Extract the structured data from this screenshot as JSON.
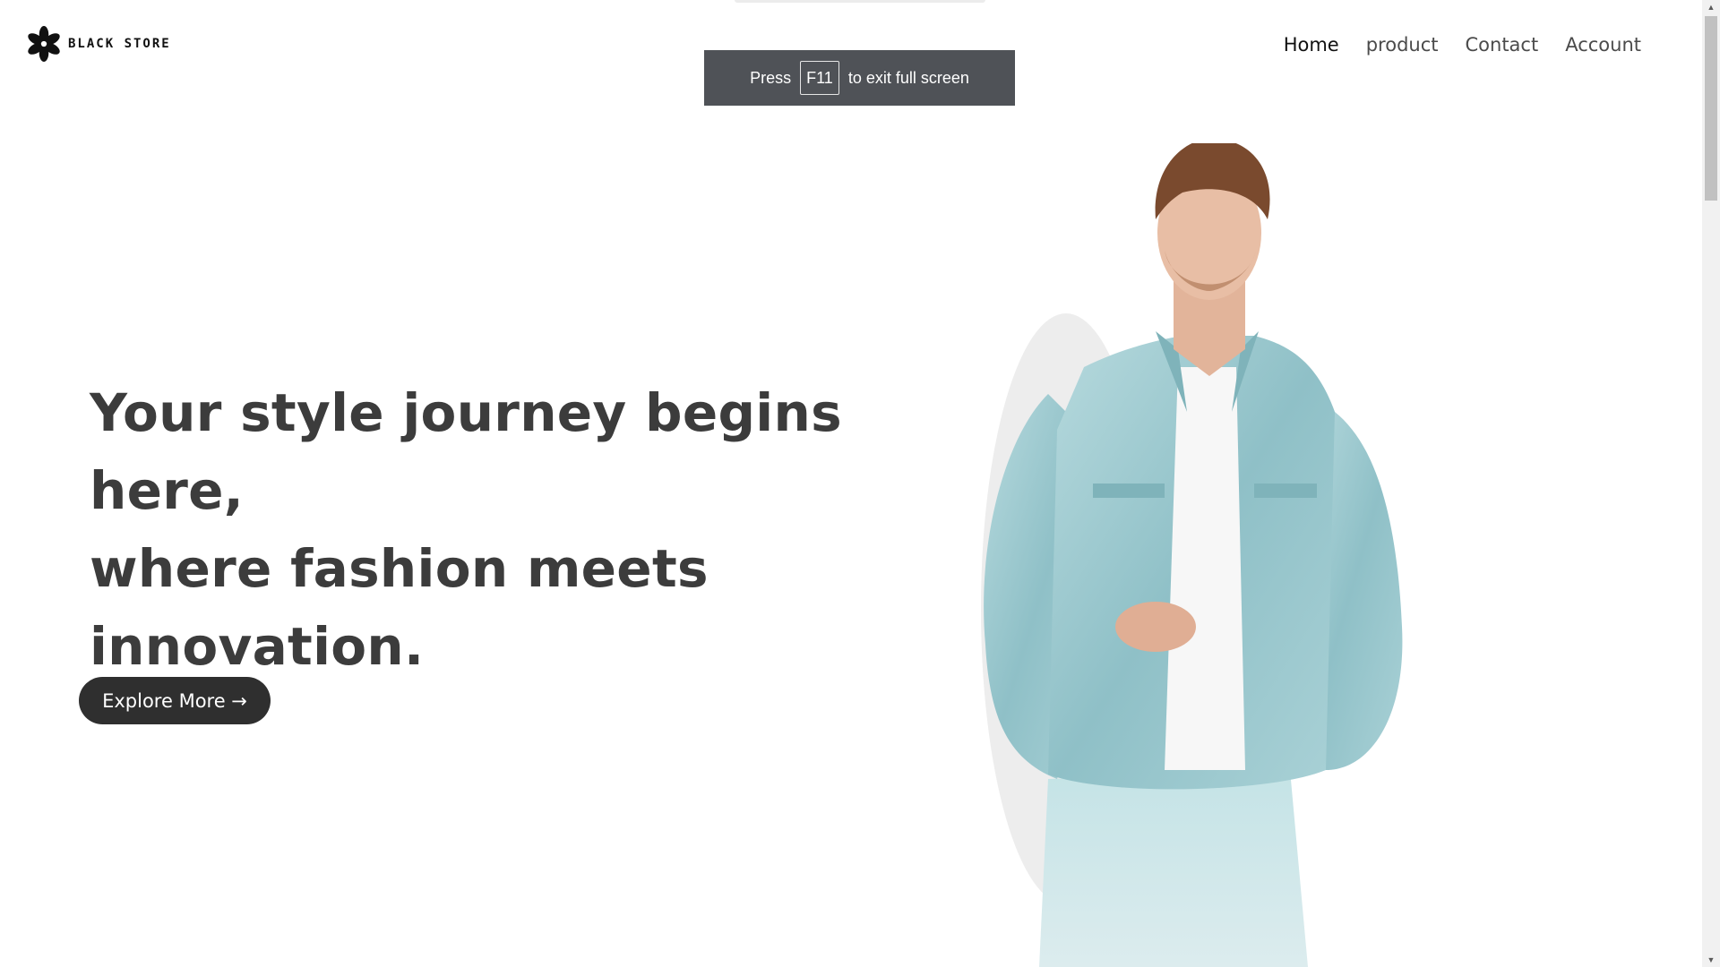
{
  "brand": {
    "name": "BLACK STORE",
    "logo_icon": "flower-icon"
  },
  "nav": {
    "items": [
      "Home",
      "product",
      "Contact",
      "Account"
    ],
    "active": "Home"
  },
  "hero": {
    "title_lines": [
      "Your style journey begins here,",
      "where fashion meets",
      "innovation."
    ],
    "cta_label": "Explore More →"
  },
  "fullscreen_notice": {
    "before": "Press",
    "key": "F11",
    "after": "to exit full screen"
  },
  "colors": {
    "text_dark": "#3c3c3c",
    "button_bg": "#2f2f2f",
    "toast_bg": "#4f5257",
    "denim": "#9fc9cf"
  }
}
